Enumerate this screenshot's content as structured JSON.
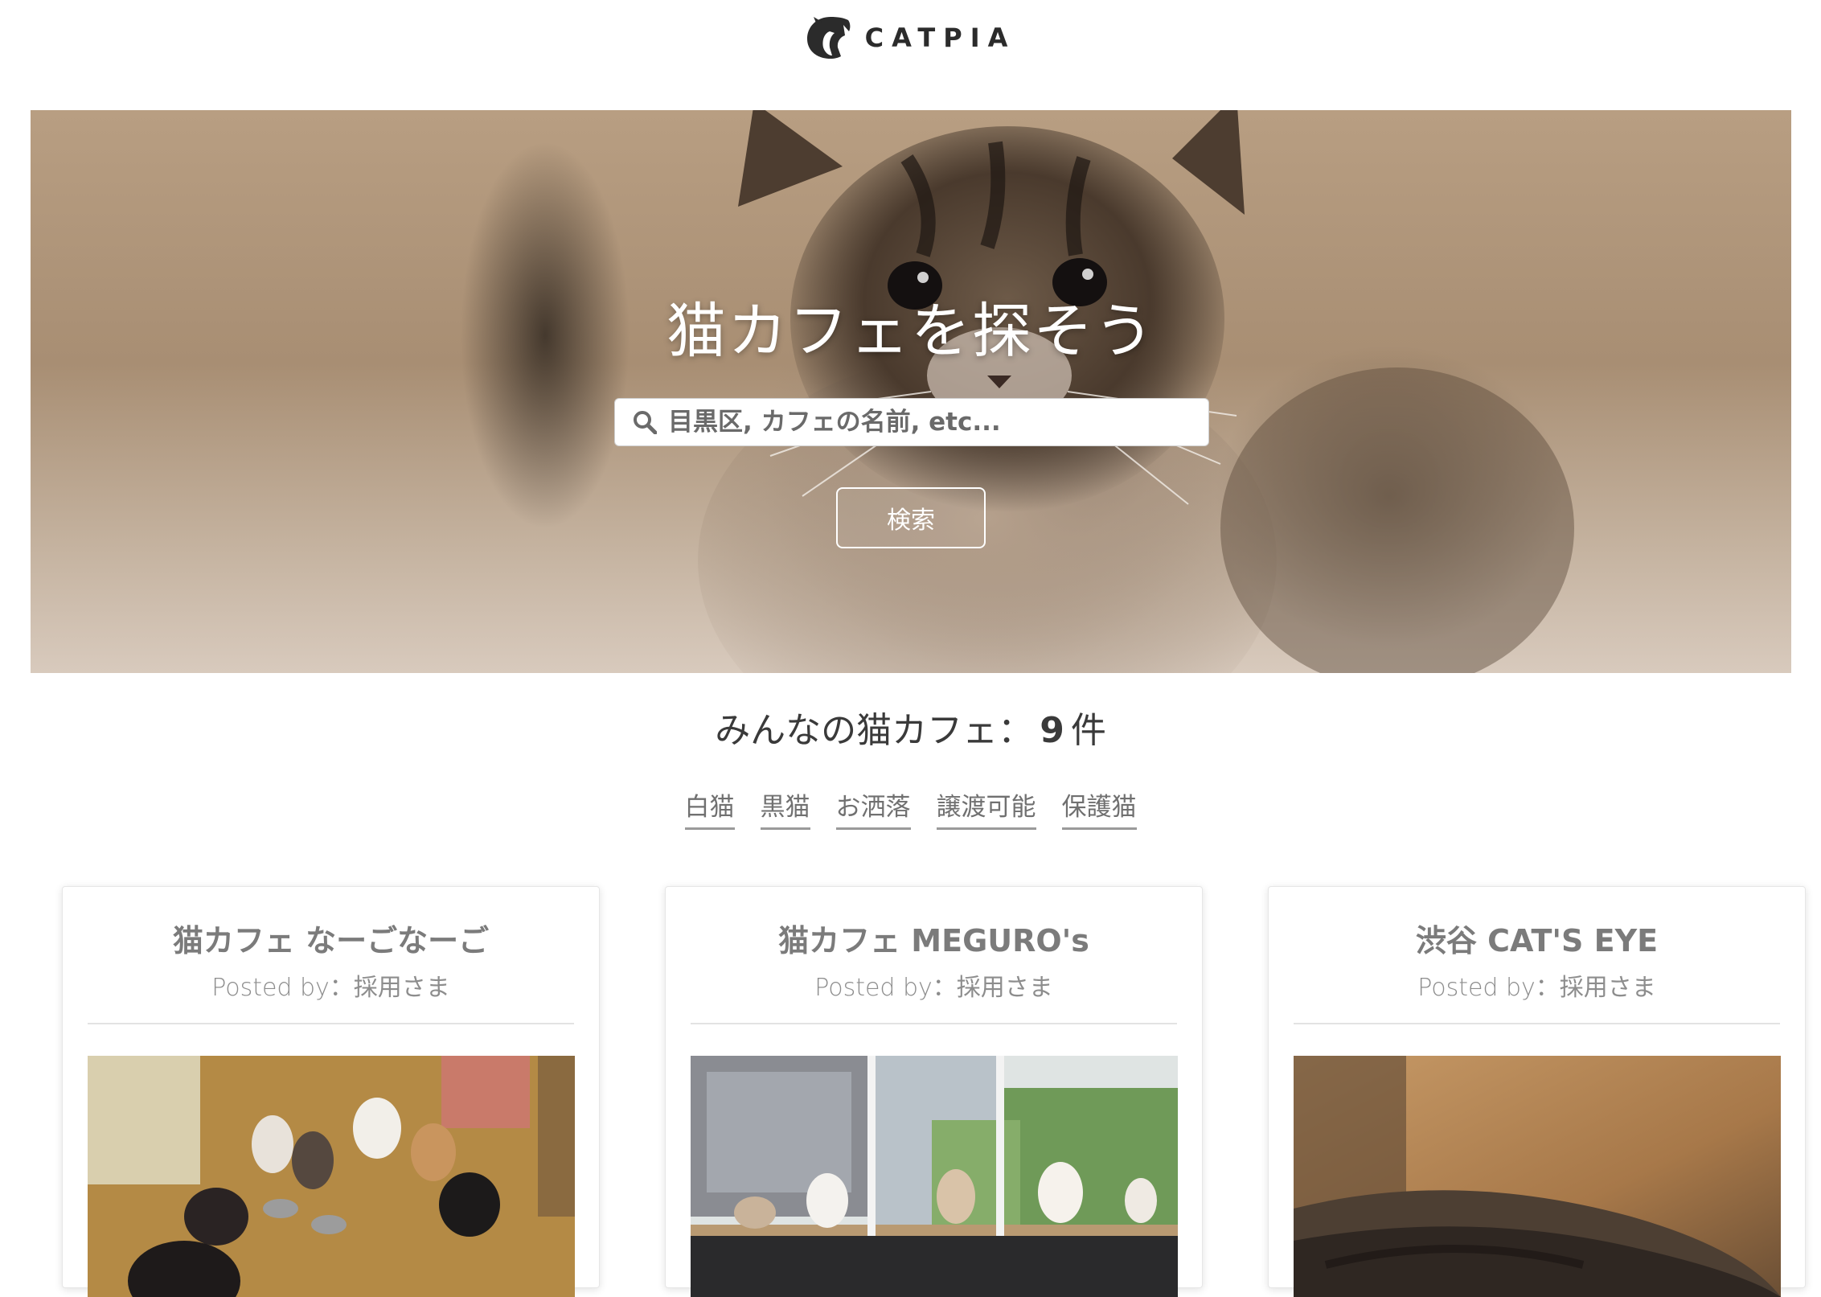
{
  "header": {
    "logo_text": "CATPIA"
  },
  "hero": {
    "title": "猫カフェを探そう",
    "search_placeholder": "目黒区, カフェの名前, etc...",
    "search_button_label": "検索"
  },
  "results": {
    "heading_label": "みんなの猫カフェ：",
    "count": "9",
    "unit": "件"
  },
  "tags": [
    {
      "label": "白猫"
    },
    {
      "label": "黒猫"
    },
    {
      "label": "お洒落"
    },
    {
      "label": "譲渡可能"
    },
    {
      "label": "保護猫"
    }
  ],
  "cards": [
    {
      "title": "猫カフェ なーごなーご",
      "posted_label": "Posted by",
      "posted_by": "：採用さま"
    },
    {
      "title": "猫カフェ MEGURO's",
      "posted_label": "Posted by",
      "posted_by": "：採用さま"
    },
    {
      "title": "渋谷 CAT'S EYE",
      "posted_label": "Posted by",
      "posted_by": "：採用さま"
    }
  ],
  "icons": {
    "logo": "cat-logo-icon",
    "search": "search-icon"
  }
}
